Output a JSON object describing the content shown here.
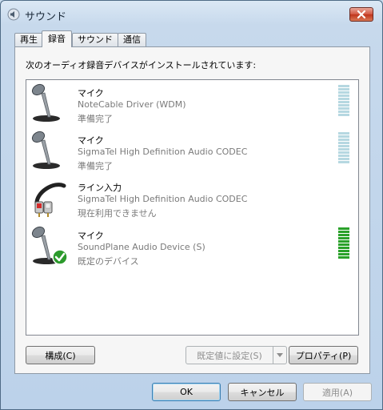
{
  "window": {
    "title": "サウンド",
    "close_label": "✕"
  },
  "tabs": [
    {
      "label": "再生"
    },
    {
      "label": "録音"
    },
    {
      "label": "サウンド"
    },
    {
      "label": "通信"
    }
  ],
  "panel": {
    "instruction": "次のオーディオ録音デバイスがインストールされています:"
  },
  "devices": [
    {
      "name": "マイク",
      "driver": "NoteCable Driver (WDM)",
      "status": "準備完了",
      "icon": "microphone-icon",
      "level": 0
    },
    {
      "name": "マイク",
      "driver": "SigmaTel High Definition Audio CODEC",
      "status": "準備完了",
      "icon": "microphone-icon",
      "level": 0
    },
    {
      "name": "ライン入力",
      "driver": "SigmaTel High Definition Audio CODEC",
      "status": "現在利用できません",
      "icon": "line-in-cable-icon",
      "level": 0
    },
    {
      "name": "マイク",
      "driver": "SoundPlane Audio Device (S)",
      "status": "既定のデバイス",
      "icon": "microphone-default-icon",
      "level": 1
    }
  ],
  "buttons": {
    "configure": "構成(C)",
    "set_default": "既定値に設定(S)",
    "properties": "プロパティ(P)",
    "ok": "OK",
    "cancel": "キャンセル",
    "apply": "適用(A)"
  },
  "colors": {
    "meter_idle": "#b6d8e1",
    "meter_active": "#2aa12a",
    "default_check": "#2c9a2c"
  }
}
